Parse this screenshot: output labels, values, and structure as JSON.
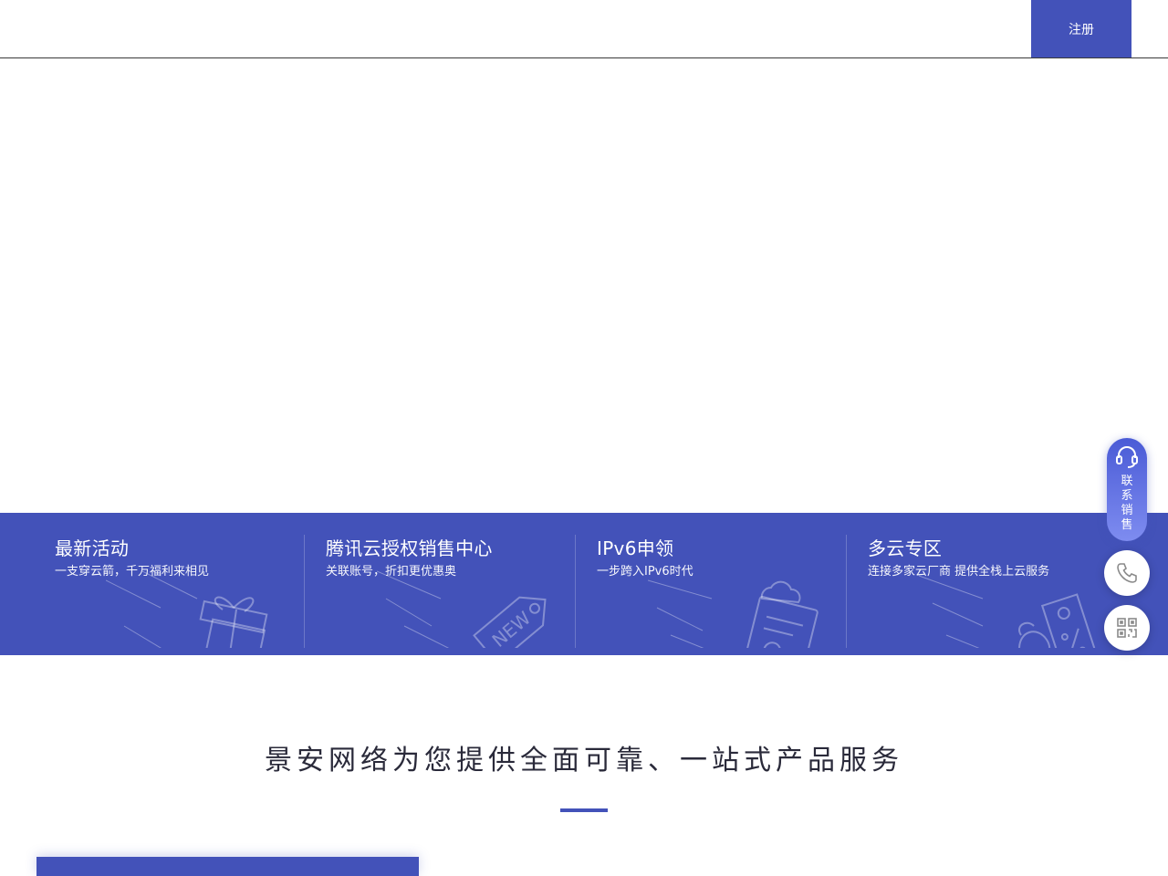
{
  "header": {
    "register_label": "注册"
  },
  "features": [
    {
      "title": "最新活动",
      "subtitle": "一支穿云箭，千万福利来相见",
      "icon": "gift-icon"
    },
    {
      "title": "腾讯云授权销售中心",
      "subtitle": "关联账号，折扣更优惠奥",
      "icon": "new-tag-icon"
    },
    {
      "title": "IPv6申领",
      "subtitle": "一步跨入IPv6时代",
      "icon": "cloud-document-icon"
    },
    {
      "title": "多云专区",
      "subtitle": "连接多家云厂商 提供全栈上云服务",
      "icon": "discount-tag-icon"
    }
  ],
  "tag_text": "NEW",
  "section": {
    "title": "景安网络为您提供全面可靠、一站式产品服务"
  },
  "float_bar": {
    "sales_label": "联系销售",
    "sales_chars": [
      "联",
      "系",
      "销",
      "售"
    ]
  },
  "colors": {
    "primary": "#4352b9",
    "text_dark": "#2a2a3a",
    "white": "#ffffff"
  }
}
